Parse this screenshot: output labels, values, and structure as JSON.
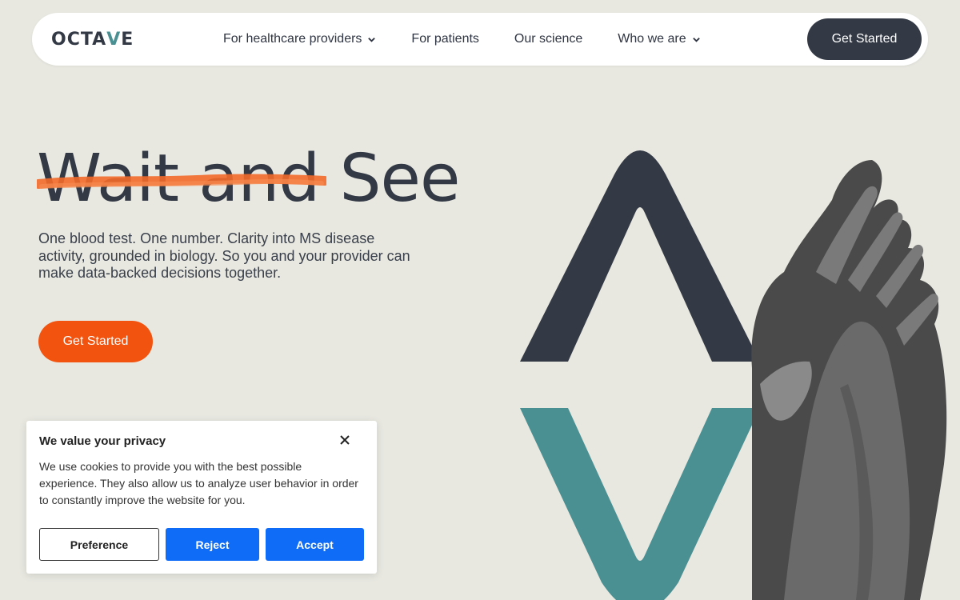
{
  "nav": {
    "logo_main": "OCTA",
    "logo_accent": "V",
    "logo_tail": "E",
    "links": [
      {
        "label": "For healthcare providers",
        "dropdown": true
      },
      {
        "label": "For patients",
        "dropdown": false
      },
      {
        "label": "Our science",
        "dropdown": false
      },
      {
        "label": "Who we are",
        "dropdown": true
      }
    ],
    "cta_label": "Get Started"
  },
  "hero": {
    "struck_text": "Wait and",
    "title_tail": "See",
    "subtitle": "One blood test. One number. Clarity into MS disease activity, grounded in biology. So you and your provider can make data-backed decisions together.",
    "cta_label": "Get Started"
  },
  "cookie": {
    "title": "We value your privacy",
    "text": "We use cookies to provide you with the best possible experience. They also allow us to analyze user behavior in order to constantly improve the website for you.",
    "preference_label": "Preference",
    "reject_label": "Reject",
    "accept_label": "Accept"
  },
  "colors": {
    "background": "#e8e8e1",
    "dark": "#333945",
    "teal": "#4a8f92",
    "orange": "#f25410",
    "blue": "#0f6cf7"
  }
}
